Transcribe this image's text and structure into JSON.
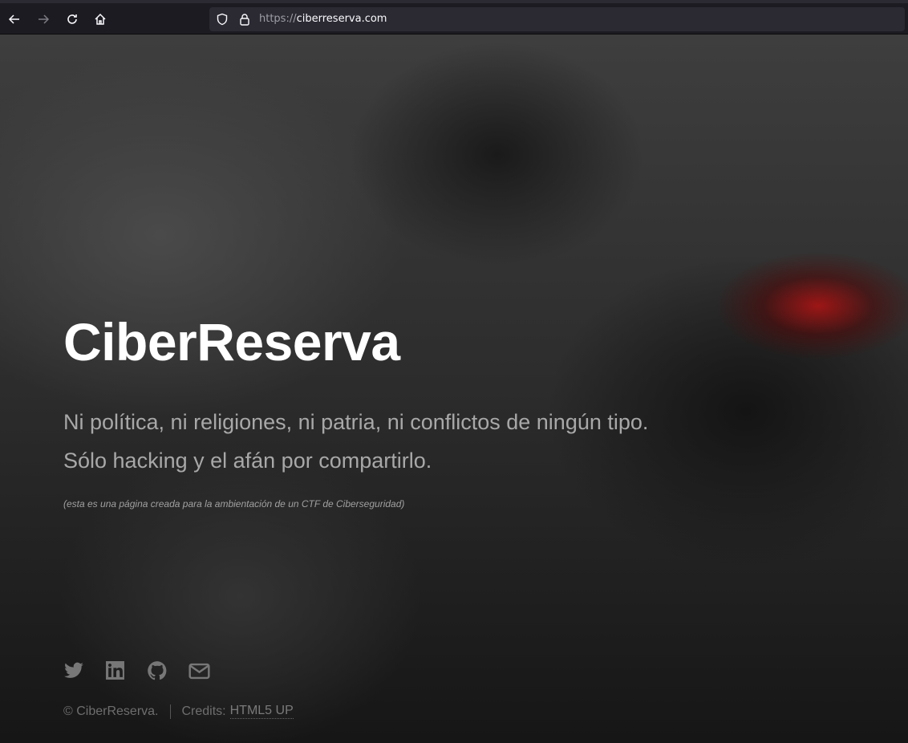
{
  "browser": {
    "url_protocol": "https://",
    "url_host": "ciberreserva.com"
  },
  "hero": {
    "title": "CiberReserva",
    "subtitle_line1": "Ni política, ni religiones, ni patria, ni conflictos de ningún tipo.",
    "subtitle_line2": "Sólo hacking y el afán por compartirlo.",
    "note": "(esta es una página creada para la ambientación de un CTF de Ciberseguridad)"
  },
  "social": [
    "twitter-icon",
    "linkedin-icon",
    "github-icon",
    "envelope-icon"
  ],
  "footer": {
    "copyright": "© CiberReserva.",
    "credits_label": "Credits:",
    "credits_link": "HTML5 UP"
  }
}
